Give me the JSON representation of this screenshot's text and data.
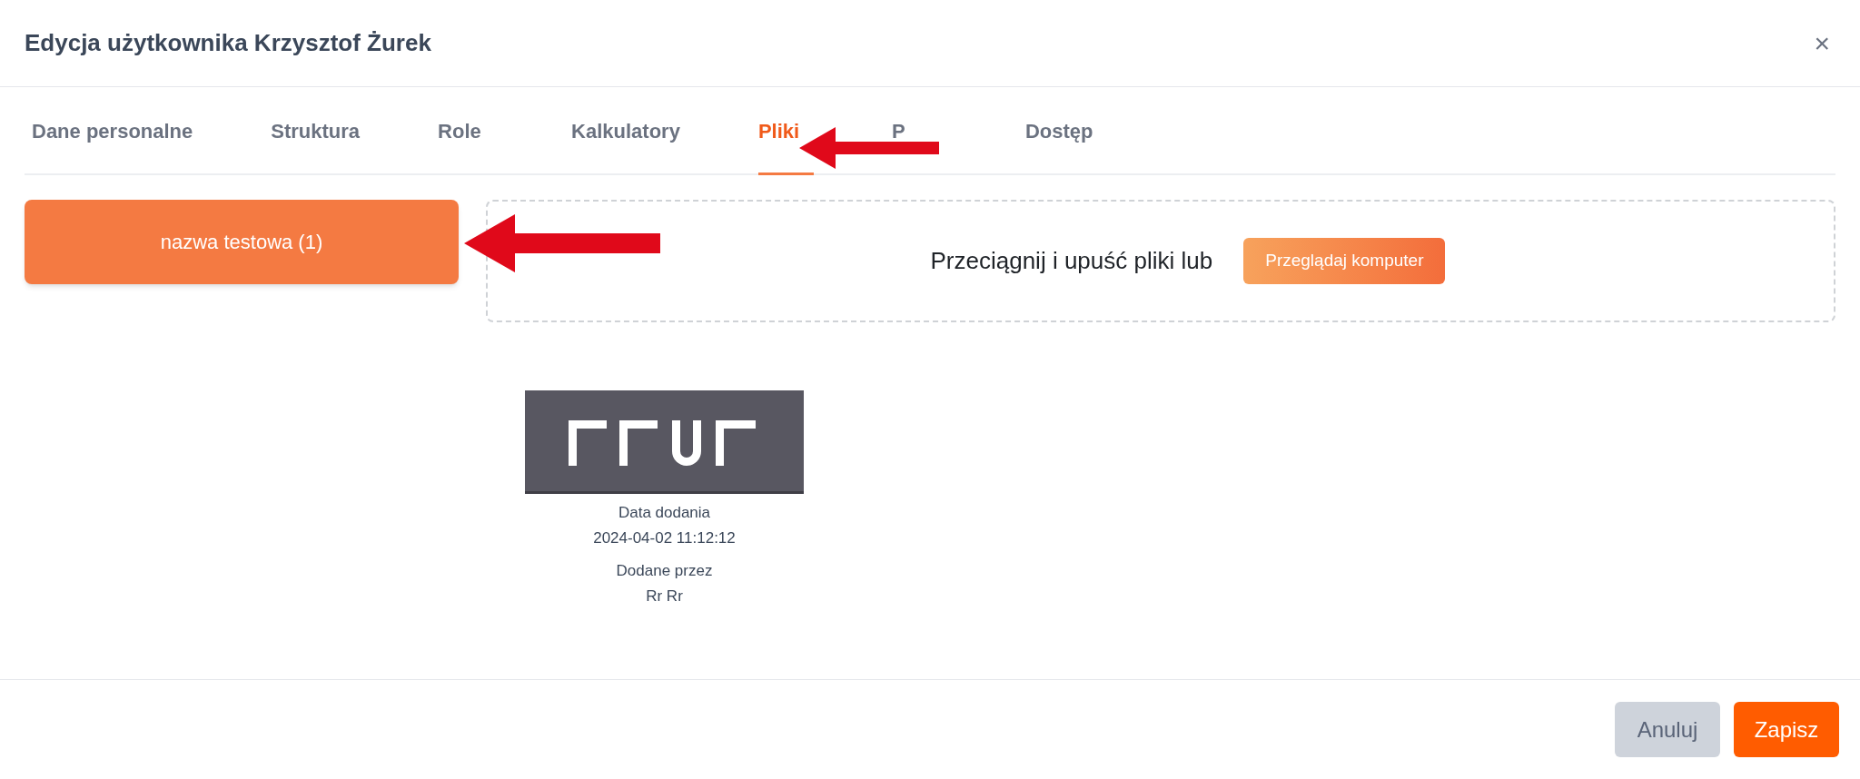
{
  "dialog": {
    "title": "Edycja użytkownika Krzysztof Żurek",
    "close": "×"
  },
  "tabs": [
    {
      "label": "Dane personalne",
      "selected": false
    },
    {
      "label": "Struktura",
      "selected": false
    },
    {
      "label": "Role",
      "selected": false
    },
    {
      "label": "Kalkulatory",
      "selected": false
    },
    {
      "label": "Pliki",
      "selected": true
    },
    {
      "label": "P",
      "selected": false
    },
    {
      "label": "Dostęp",
      "selected": false
    }
  ],
  "folders": [
    {
      "label": "nazwa testowa (1)"
    }
  ],
  "dropzone": {
    "text": "Przeciągnij i upuść pliki lub",
    "button": "Przeglądaj komputer"
  },
  "files": [
    {
      "kind": "picture",
      "added_label": "Data dodania",
      "added_date": "2024-04-02 11:12:12",
      "by_label": "Dodane przez",
      "by_value": "Rr Rr"
    }
  ],
  "footer_buttons": [
    {
      "label": "Anuluj",
      "kind": "secondary"
    },
    {
      "label": "Zapisz",
      "kind": "primary"
    }
  ]
}
